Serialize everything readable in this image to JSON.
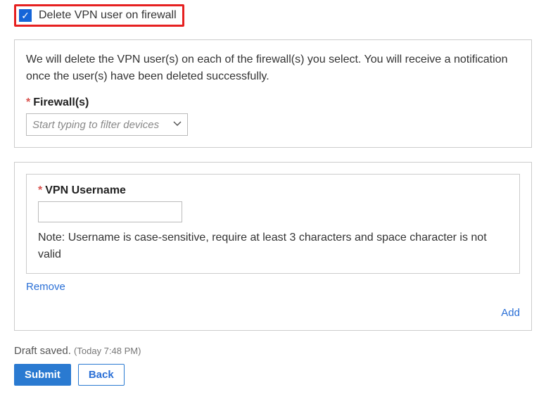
{
  "checkbox": {
    "label": "Delete VPN user on firewall",
    "checked": true
  },
  "firewall_section": {
    "description": "We will delete the VPN user(s) on each of the firewall(s) you select. You will receive a notification once the user(s) have been deleted successfully.",
    "field_label": "Firewall(s)",
    "combo_placeholder": "Start typing to filter devices"
  },
  "user_section": {
    "field_label": "VPN Username",
    "input_value": "",
    "note": "Note: Username is case-sensitive, require at least 3 characters and space character is not valid",
    "remove_label": "Remove",
    "add_label": "Add"
  },
  "footer": {
    "draft_saved_label": "Draft saved.",
    "timestamp": "(Today 7:48 PM)",
    "submit_label": "Submit",
    "back_label": "Back"
  }
}
